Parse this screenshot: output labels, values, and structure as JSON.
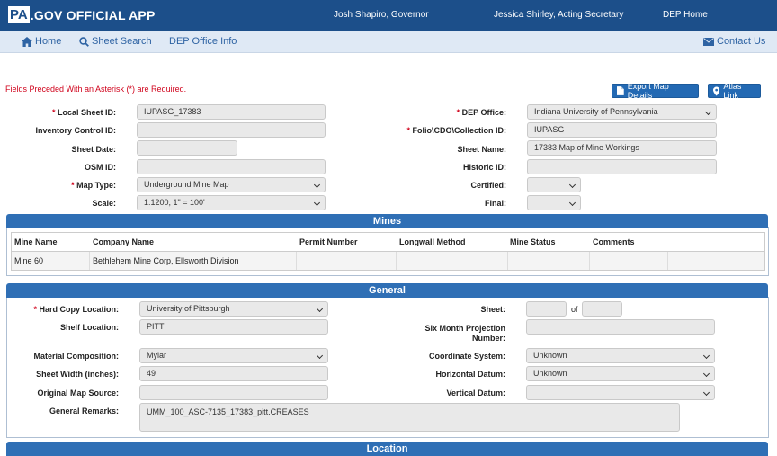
{
  "header": {
    "logo_text": "PA",
    "brand_suffix": ".GOV OFFICIAL APP",
    "governor": "Josh Shapiro, Governor",
    "secretary": "Jessica Shirley, Acting Secretary",
    "dep_home": "DEP Home"
  },
  "nav": {
    "home": "Home",
    "sheet_search": "Sheet Search",
    "dep_office_info": "DEP Office Info",
    "contact_us": "Contact Us"
  },
  "form": {
    "required_note": "Fields Preceded With an Asterisk (*) are Required.",
    "export_button": "Export Map Details",
    "atlas_button": "Atlas Link",
    "local_sheet_id": {
      "label": "Local Sheet ID:",
      "value": "IUPASG_17383"
    },
    "inventory_control_id": {
      "label": "Inventory Control ID:",
      "value": ""
    },
    "sheet_date": {
      "label": "Sheet Date:",
      "value": ""
    },
    "osm_id": {
      "label": "OSM ID:",
      "value": ""
    },
    "map_type": {
      "label": "Map Type:",
      "value": "Underground Mine Map"
    },
    "scale": {
      "label": "Scale:",
      "value": "1:1200, 1\" = 100'"
    },
    "dep_office": {
      "label": "DEP Office:",
      "value": "Indiana University of Pennsylvania"
    },
    "folio": {
      "label": "Folio\\CDO\\Collection ID:",
      "value": "IUPASG"
    },
    "sheet_name": {
      "label": "Sheet Name:",
      "value": "17383  Map of Mine Workings"
    },
    "historic_id": {
      "label": "Historic ID:",
      "value": ""
    },
    "certified": {
      "label": "Certified:",
      "value": ""
    },
    "final": {
      "label": "Final:",
      "value": ""
    }
  },
  "mines": {
    "title": "Mines",
    "columns": [
      "Mine Name",
      "Company Name",
      "Permit Number",
      "Longwall Method",
      "Mine Status",
      "Comments"
    ],
    "rows": [
      [
        "Mine 60",
        "Bethlehem Mine Corp, Ellsworth Division",
        "",
        "",
        "",
        ""
      ]
    ]
  },
  "general": {
    "title": "General",
    "hard_copy_location": {
      "label": "Hard Copy Location:",
      "value": "University of Pittsburgh"
    },
    "shelf_location": {
      "label": "Shelf Location:",
      "value": "PITT"
    },
    "material_composition": {
      "label": "Material Composition:",
      "value": "Mylar"
    },
    "sheet_width": {
      "label": "Sheet Width (inches):",
      "value": "49"
    },
    "original_map_source": {
      "label": "Original Map Source:",
      "value": ""
    },
    "general_remarks": {
      "label": "General Remarks:",
      "value": "UMM_100_ASC-7135_17383_pitt.CREASES"
    },
    "sheet": {
      "label": "Sheet:",
      "value": "",
      "of_label": "of",
      "of_value": ""
    },
    "six_month_projection": {
      "label_line1": "Six Month Projection",
      "label_line2": "Number:",
      "value": ""
    },
    "coordinate_system": {
      "label": "Coordinate System:",
      "value": "Unknown"
    },
    "horizontal_datum": {
      "label": "Horizontal Datum:",
      "value": "Unknown"
    },
    "vertical_datum": {
      "label": "Vertical Datum:",
      "value": ""
    }
  },
  "location": {
    "title": "Location"
  }
}
